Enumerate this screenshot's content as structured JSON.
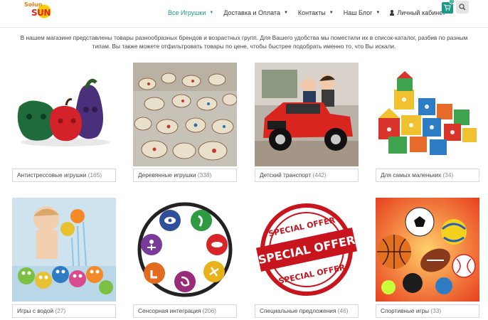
{
  "header": {
    "logo_line1": "Solun",
    "logo_line2": "SUN",
    "nav": [
      {
        "label": "Все Игрушки",
        "active": true
      },
      {
        "label": "Доставка и Оплата",
        "active": false
      },
      {
        "label": "Контакты",
        "active": false
      },
      {
        "label": "Наш Блог",
        "active": false
      },
      {
        "label": "Личный кабинет",
        "active": false
      }
    ],
    "cart_count": "0",
    "cart_icon": "cart-icon",
    "search_icon": "search-icon",
    "accent_color": "#1a9a86"
  },
  "intro": "В нашем магазине представлены товары разнообразных брендов и возрастных групп. Для Вашего удобства мы поместили их в список-каталог, разбив по разным типам. Вы также можете отфильтровать товары по цене, чтобы быстрее подобрать именно то, что Вы искали.",
  "categories": [
    {
      "name": "Антистрессовые игрушки",
      "count": "(165)"
    },
    {
      "name": "Деревянные игрушки",
      "count": "(338)"
    },
    {
      "name": "Детский транспорт",
      "count": "(442)"
    },
    {
      "name": "Для самых маленьких",
      "count": "(34)"
    },
    {
      "name": "Игры с водой",
      "count": "(27)"
    },
    {
      "name": "Сенсорная интеграция",
      "count": "(206)"
    },
    {
      "name": "Специальные предложения",
      "count": "(46)"
    },
    {
      "name": "Спортивные игры",
      "count": "(33)"
    }
  ],
  "special_offer_text": "SPECIAL OFFER"
}
